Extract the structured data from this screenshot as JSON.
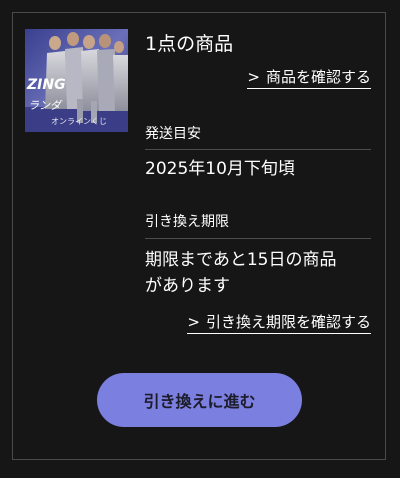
{
  "product": {
    "thumbnail_logo_line1": "ZING",
    "thumbnail_logo_line2": "ランダ",
    "thumbnail_caption": "オンラインくじ",
    "item_count": "1点の商品",
    "view_products_link": "商品を確認する",
    "link_icon": "chevron-right-icon"
  },
  "shipping": {
    "label": "発送目安",
    "value": "2025年10月下旬頃"
  },
  "exchange": {
    "label": "引き換え期限",
    "value_line1": "期限まであと15日の商品",
    "value_line2": "があります",
    "view_deadline_link": "引き換え期限を確認する"
  },
  "action": {
    "exchange_button": "引き換えに進む"
  },
  "colors": {
    "background": "#161616",
    "border": "#4a4a4a",
    "button": "#7b7fe0",
    "button_text": "#1c1c2a"
  }
}
